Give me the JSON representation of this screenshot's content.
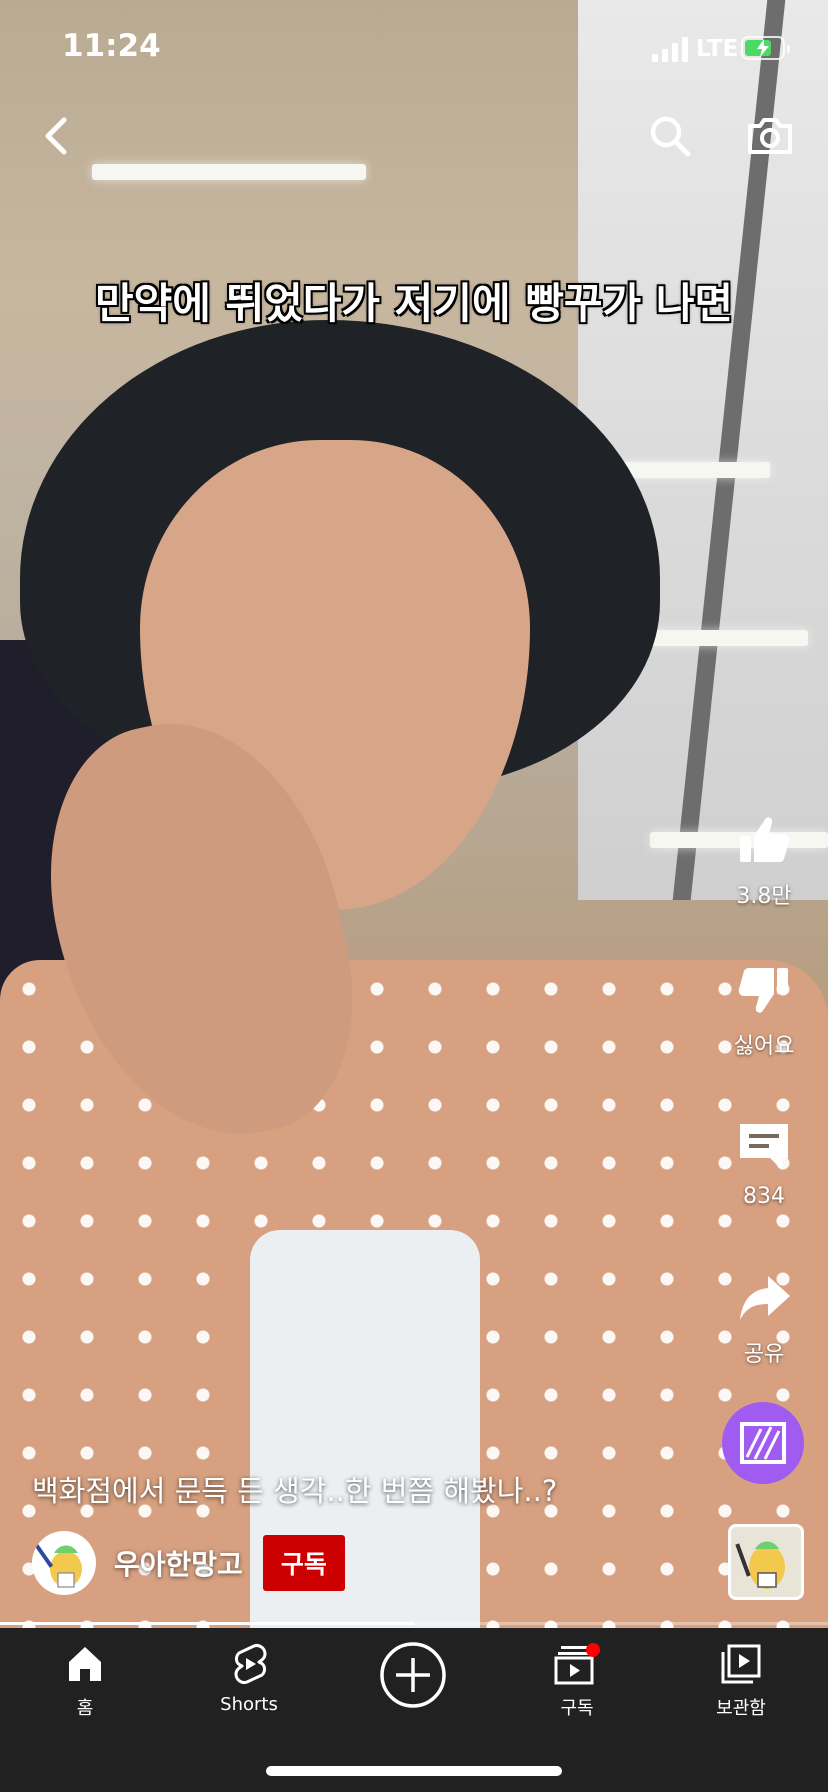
{
  "status_bar": {
    "time": "11:24",
    "network": "LTE",
    "battery_color": "#4cd964"
  },
  "top_bar": {
    "back_icon": "chevron-left-icon",
    "search_icon": "search-icon",
    "camera_icon": "camera-icon"
  },
  "video": {
    "caption_overlay": "만약에 뛰었다가 저기에 빵꾸가 나면",
    "title": "백화점에서 문득 든 생각..한 번쯤 해봤나..?",
    "channel_name": "우아한망고",
    "subscribe_label": "구독",
    "progress_fraction": 0.5
  },
  "actions": {
    "like_count": "3.8만",
    "dislike_label": "싫어요",
    "comment_count": "834",
    "share_label": "공유"
  },
  "bottom_nav": {
    "home": "홈",
    "shorts": "Shorts",
    "subscriptions": "구독",
    "library": "보관함"
  },
  "colors": {
    "accent_red": "#cc0000",
    "remix_purple": "#a05bf0",
    "nav_bg": "#212121"
  }
}
